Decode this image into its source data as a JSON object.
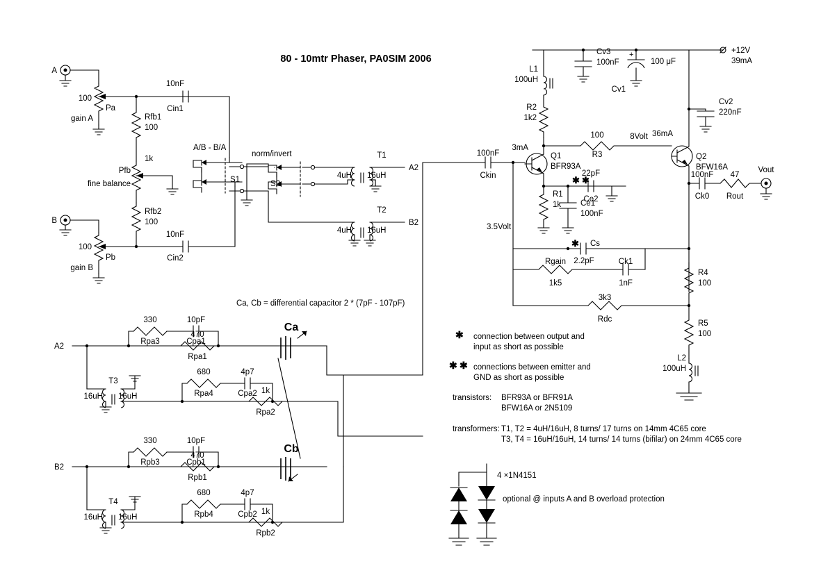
{
  "title": "80 - 10mtr Phaser, PA0SIM  2006",
  "inputs": {
    "a_label": "A",
    "b_label": "B",
    "gain_a": "gain A",
    "gain_b": "gain B",
    "pa_ref": "Pa",
    "pa_val": "100",
    "pb_ref": "Pb",
    "pb_val": "100",
    "rfb1_ref": "Rfb1",
    "rfb1_val": "100",
    "rfb2_ref": "Rfb2",
    "rfb2_val": "100",
    "pfb_ref": "Pfb",
    "pfb_val": "1k",
    "pfb_note": "fine balance",
    "cin1_ref": "Cin1",
    "cin1_val": "10nF",
    "cin2_ref": "Cin2",
    "cin2_val": "10nF"
  },
  "switches": {
    "s1_ref": "S1",
    "s1_label": "A/B - B/A",
    "s2_ref": "S2",
    "s2_label": "norm/invert"
  },
  "transformers_top": {
    "t1_ref": "T1",
    "t1_pri": "4uH",
    "t1_sec": "16uH",
    "t1_out": "A2",
    "t2_ref": "T2",
    "t2_pri": "4uH",
    "t2_sec": "16uH",
    "t2_out": "B2"
  },
  "phase_a": {
    "input_label": "A2",
    "rpa3_ref": "Rpa3",
    "rpa3_val": "330",
    "cpa1_ref": "Cpa1",
    "cpa1_val": "10pF",
    "rpa1_ref": "Rpa1",
    "rpa1_val": "470",
    "t3_ref": "T3",
    "t3_pri": "16uH",
    "t3_sec": "16uH",
    "rpa4_ref": "Rpa4",
    "rpa4_val": "680",
    "cpa2_ref": "Cpa2",
    "cpa2_val": "4p7",
    "rpa2_ref": "Rpa2",
    "rpa2_val": "1k",
    "ca_label": "Ca"
  },
  "phase_b": {
    "input_label": "B2",
    "rpb3_ref": "Rpb3",
    "rpb3_val": "330",
    "cpb1_ref": "Cpb1",
    "cpb1_val": "10pF",
    "rpb1_ref": "Rpb1",
    "rpb1_val": "470",
    "t4_ref": "T4",
    "t4_pri": "16uH",
    "t4_sec": "16uH",
    "rpb4_ref": "Rpb4",
    "rpb4_val": "680",
    "cpb2_ref": "Cpb2",
    "cpb2_val": "4p7",
    "rpb2_ref": "Rpb2",
    "rpb2_val": "1k",
    "cb_label": "Cb"
  },
  "cap_note": "Ca, Cb = differential capacitor 2 * (7pF - 107pF)",
  "amp": {
    "ckin_ref": "Ckin",
    "ckin_val": "100nF",
    "node_3v5": "3.5Volt",
    "q1_ref": "Q1",
    "q1_type": "BFR93A",
    "q1_current": "3mA",
    "l1_ref": "L1",
    "l1_val": "100uH",
    "r2_ref": "R2",
    "r2_val": "1k2",
    "cv3_ref": "Cv3",
    "cv3_val": "100nF",
    "cv1_ref": "Cv1",
    "cv1_val": "100 μF",
    "cv1_polarity": "+",
    "supply_label": "+12V",
    "supply_current": "39mA",
    "r3_ref": "R3",
    "r3_val": "100",
    "node_8v": "8Volt",
    "q2_ref": "Q2",
    "q2_type": "BFW16A",
    "q2_current": "36mA",
    "cv2_ref": "Cv2",
    "cv2_val": "220nF",
    "r1_ref": "R1",
    "r1_val": "1k",
    "ce1_ref": "Ce1",
    "ce1_val": "100nF",
    "ce2_ref": "Ce2",
    "ce2_val": "22pF",
    "cs_ref": "Cs",
    "cs_val": "2.2pF",
    "rgain_ref": "Rgain",
    "rgain_val": "1k5",
    "ck1_ref": "Ck1",
    "ck1_val": "1nF",
    "rdc_ref": "Rdc",
    "rdc_val": "3k3",
    "ck0_ref": "Ck0",
    "ck0_val": "100nF",
    "rout_ref": "Rout",
    "rout_val": "47",
    "vout_label": "Vout",
    "r4_ref": "R4",
    "r4_val": "100",
    "r5_ref": "R5",
    "r5_val": "100",
    "l2_ref": "L2",
    "l2_val": "100uH"
  },
  "notes": {
    "star1_line1": "connection between output and",
    "star1_line2": "input as short as possible",
    "star2_line1": "connections between emitter and",
    "star2_line2": "GND as short as possible",
    "transistors_label": "transistors:",
    "transistors_line1": "BFR93A  or  BFR91A",
    "transistors_line2": "BFW16A or  2N5109",
    "transformers_label": "transformers:",
    "transformers_line1": "T1, T2 =  4uH/16uH,  8 turns/ 17 turns on 14mm 4C65 core",
    "transformers_line2": "T3, T4 =  16uH/16uH,  14 turns/ 14 turns (bifilar) on 24mm 4C65 core",
    "diode_count": "4 ×1N4151",
    "diode_note": "optional @ inputs A and B overload protection"
  }
}
